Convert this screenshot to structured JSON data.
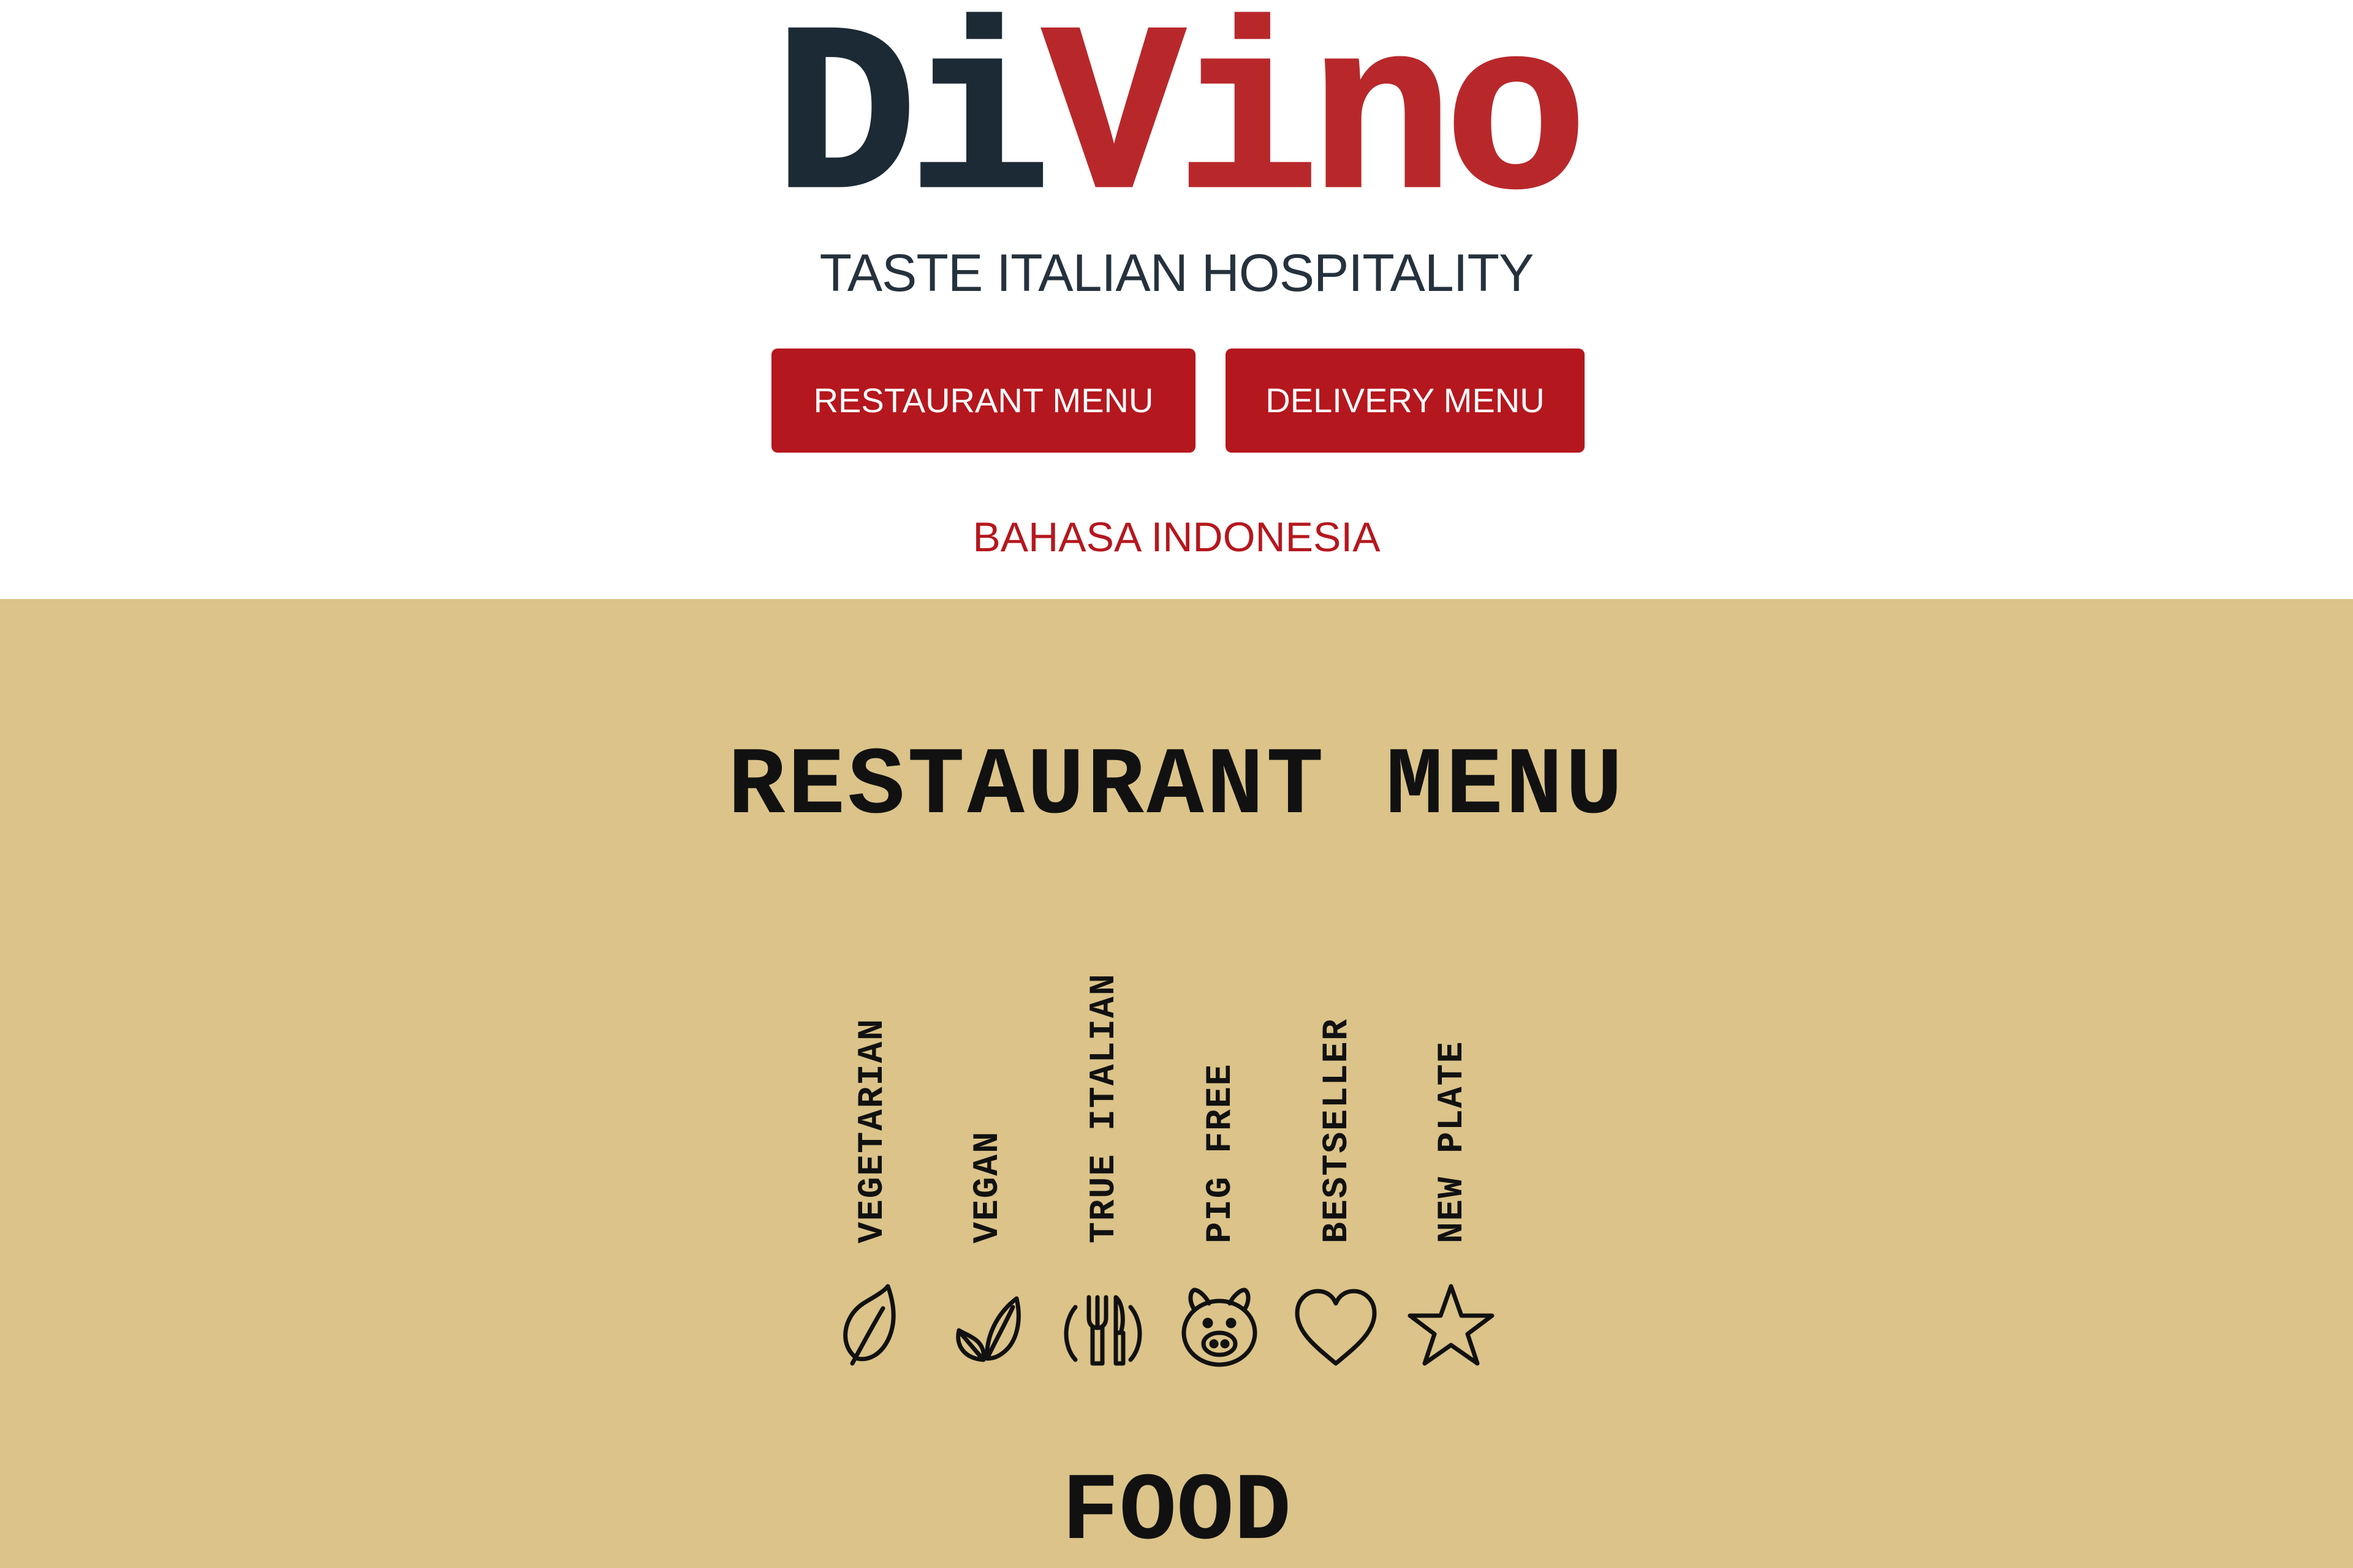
{
  "brand": {
    "logo_part1": "Di",
    "logo_part2": "Vino",
    "tagline": "TASTE ITALIAN HOSPITALITY",
    "colors": {
      "dark": "#1c2a35",
      "red": "#b8282b",
      "button": "#b5171e",
      "section_bg": "#dbc389"
    }
  },
  "nav": {
    "restaurant_menu_label": "RESTAURANT MENU",
    "delivery_menu_label": "DELIVERY MENU",
    "language_link": "BAHASA INDONESIA"
  },
  "menu": {
    "title": "RESTAURANT MENU",
    "legend": [
      {
        "label": "VEGETARIAN",
        "icon": "leaf-icon"
      },
      {
        "label": "VEGAN",
        "icon": "two-leaves-icon"
      },
      {
        "label": "TRUE ITALIAN",
        "icon": "fork-knife-icon"
      },
      {
        "label": "PIG FREE",
        "icon": "pig-icon"
      },
      {
        "label": "BESTSELLER",
        "icon": "heart-icon"
      },
      {
        "label": "NEW PLATE",
        "icon": "star-icon"
      }
    ],
    "food_heading": "FOOD"
  }
}
